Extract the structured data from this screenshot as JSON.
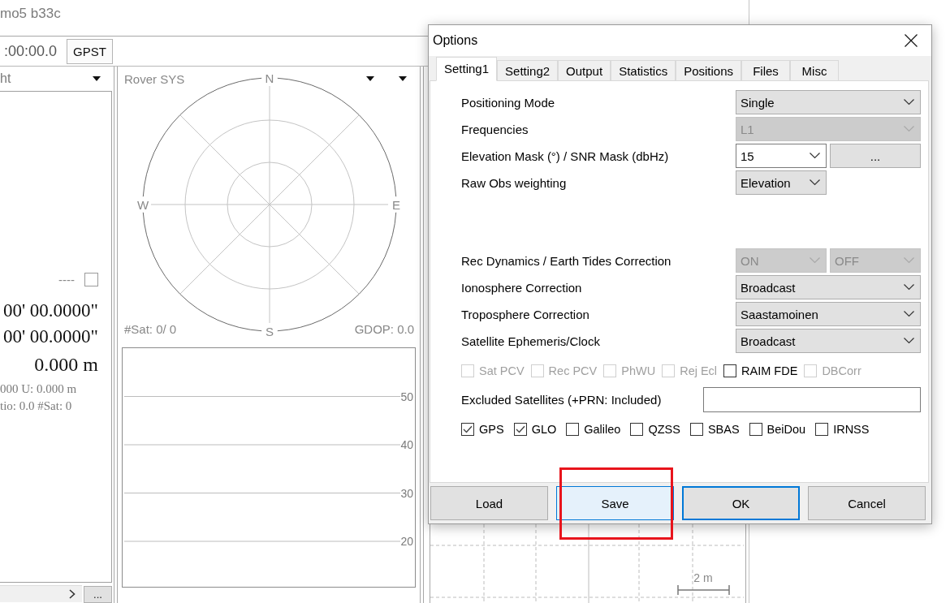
{
  "app_window": {
    "title": "mo5 b33c",
    "toolbar": {
      "time": ":00:00.0",
      "time_system_button": "GPST"
    },
    "solution_panel": {
      "header": "ht",
      "status": "----",
      "status_checkbox": {
        "checked": false
      },
      "position_lines": [
        {
          "kind": "angle",
          "text": "00' 00.0000\""
        },
        {
          "kind": "angle",
          "text": "00' 00.0000\""
        },
        {
          "kind": "distance",
          "text": "0.000 m"
        }
      ],
      "info_lines": [
        "000 U: 0.000 m",
        "tio: 0.0 #Sat: 0"
      ],
      "more_button": "..."
    },
    "sky_panel": {
      "header": "Rover SYS",
      "directions": [
        "N",
        "E",
        "S",
        "W"
      ],
      "satellite_count": "#Sat: 0/ 0",
      "gdop": "GDOP: 0.0",
      "snr_grid_labels": [
        "50",
        "40",
        "30",
        "20"
      ]
    },
    "position_panel": {
      "scale_label": "2 m"
    }
  },
  "options_dialog": {
    "title": "Options",
    "tabs": [
      {
        "label": "Setting1",
        "selected": true
      },
      {
        "label": "Setting2",
        "selected": false
      },
      {
        "label": "Output",
        "selected": false
      },
      {
        "label": "Statistics",
        "selected": false
      },
      {
        "label": "Positions",
        "selected": false
      },
      {
        "label": "Files",
        "selected": false
      },
      {
        "label": "Misc",
        "selected": false
      }
    ],
    "positioning_rows": [
      {
        "label": "Positioning Mode",
        "controls": [
          {
            "kind": "dropdown",
            "value": "Single",
            "disabled": false
          }
        ]
      },
      {
        "label": "Frequencies",
        "controls": [
          {
            "kind": "dropdown",
            "value": "L1",
            "disabled": true
          }
        ]
      },
      {
        "label": "Elevation Mask (°) / SNR Mask (dbHz)",
        "controls": [
          {
            "kind": "combo",
            "value": "15",
            "disabled": false
          },
          {
            "kind": "button",
            "value": "...",
            "disabled": false
          }
        ]
      },
      {
        "label": "Raw Obs weighting",
        "controls": [
          {
            "kind": "narrow_dropdown",
            "value": "Elevation",
            "disabled": false
          }
        ]
      }
    ],
    "correction_rows": [
      {
        "label": "Rec Dynamics / Earth Tides Correction",
        "controls": [
          {
            "kind": "narrow_dropdown",
            "value": "ON",
            "disabled": true
          },
          {
            "kind": "narrow_dropdown",
            "value": "OFF",
            "disabled": true
          }
        ]
      },
      {
        "label": "Ionosphere Correction",
        "controls": [
          {
            "kind": "dropdown",
            "value": "Broadcast",
            "disabled": false
          }
        ]
      },
      {
        "label": "Troposphere Correction",
        "controls": [
          {
            "kind": "dropdown",
            "value": "Saastamoinen",
            "disabled": false
          }
        ]
      },
      {
        "label": "Satellite Ephemeris/Clock",
        "controls": [
          {
            "kind": "dropdown",
            "value": "Broadcast",
            "disabled": false
          }
        ]
      }
    ],
    "option_checkboxes": [
      {
        "label": "Sat PCV",
        "checked": false,
        "disabled": true
      },
      {
        "label": "Rec PCV",
        "checked": false,
        "disabled": true
      },
      {
        "label": "PhWU",
        "checked": false,
        "disabled": true
      },
      {
        "label": "Rej Ecl",
        "checked": false,
        "disabled": true
      },
      {
        "label": "RAIM FDE",
        "checked": false,
        "disabled": false
      },
      {
        "label": "DBCorr",
        "checked": false,
        "disabled": true
      }
    ],
    "excluded_satellites": {
      "label": "Excluded Satellites (+PRN: Included)"
    },
    "constellations": [
      {
        "label": "GPS",
        "checked": true
      },
      {
        "label": "GLO",
        "checked": true
      },
      {
        "label": "Galileo",
        "checked": false
      },
      {
        "label": "QZSS",
        "checked": false
      },
      {
        "label": "SBAS",
        "checked": false
      },
      {
        "label": "BeiDou",
        "checked": false
      },
      {
        "label": "IRNSS",
        "checked": false
      }
    ],
    "buttons": [
      {
        "label": "Load",
        "hovered": false,
        "default": false,
        "highlighted": false
      },
      {
        "label": "Save",
        "hovered": true,
        "default": false,
        "highlighted": true
      },
      {
        "label": "OK",
        "hovered": false,
        "default": true,
        "highlighted": false
      },
      {
        "label": "Cancel",
        "hovered": false,
        "default": false,
        "highlighted": false
      }
    ]
  }
}
